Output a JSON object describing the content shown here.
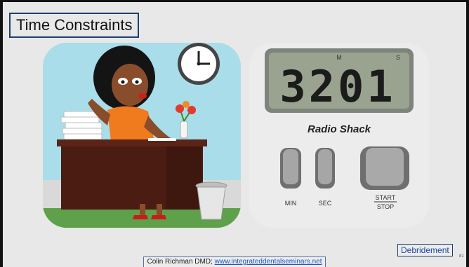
{
  "slide": {
    "title": "Time Constraints",
    "footer_author": "Colin Richman DMD; ",
    "footer_link": "www.integrateddentalseminars.net",
    "debrief_label": "Debridement",
    "slide_number": "81"
  },
  "timer": {
    "display_digits": "3201",
    "brand": "Radio Shack",
    "label_m": "M",
    "label_s": "S",
    "min_label": "MIN",
    "sec_label": "SEC",
    "start_label": "START",
    "stop_label": "STOP"
  },
  "colors": {
    "title_border": "#1e3e6e",
    "link": "#1a55c4",
    "illustration_sky": "#a9dde9",
    "desk": "#4a1c12",
    "shirt": "#f07a1e",
    "lcd": "#9aa38f"
  },
  "icons": [
    "clock-icon",
    "flower-vase-icon",
    "trash-can-icon"
  ]
}
